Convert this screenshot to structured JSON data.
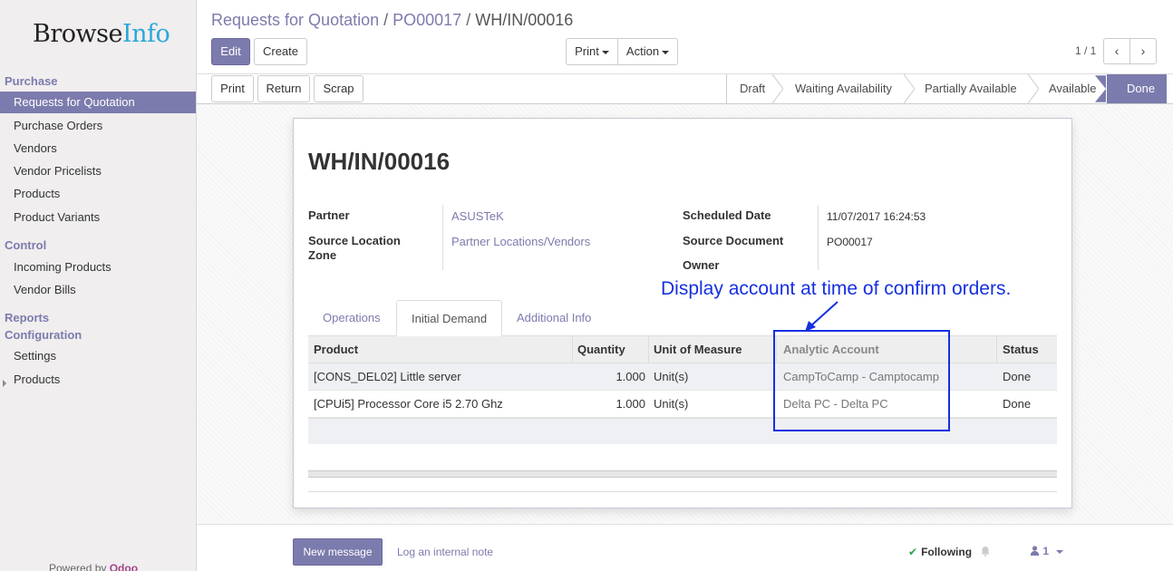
{
  "brand": {
    "part1": "Browse",
    "part2": "Info"
  },
  "sidebar": {
    "sections": [
      {
        "label": "Purchase"
      },
      {
        "label": "Control"
      },
      {
        "label": "Reports"
      },
      {
        "label": "Configuration"
      }
    ],
    "purchase_items": [
      "Requests for Quotation",
      "Purchase Orders",
      "Vendors",
      "Vendor Pricelists",
      "Products",
      "Product Variants"
    ],
    "control_items": [
      "Incoming Products",
      "Vendor Bills"
    ],
    "config_items": [
      "Settings",
      "Products"
    ],
    "powered_by": "Powered by",
    "powered_brand": "Odoo"
  },
  "breadcrumb": [
    "Requests for Quotation",
    "PO00017",
    "WH/IN/00016"
  ],
  "toolbar": {
    "edit": "Edit",
    "create": "Create",
    "print": "Print",
    "action": "Action"
  },
  "pager": {
    "text": "1 / 1",
    "prev": "‹",
    "next": "›"
  },
  "header_buttons": {
    "print": "Print",
    "return": "Return",
    "scrap": "Scrap"
  },
  "stages": [
    "Draft",
    "Waiting Availability",
    "Partially Available",
    "Available",
    "Done"
  ],
  "current_stage": "Done",
  "record": {
    "title": "WH/IN/00016",
    "partner_label": "Partner",
    "partner_value": "ASUSTeK",
    "source_location_label_1": "Source Location",
    "source_location_label_2": "Zone",
    "source_location_value": "Partner Locations/Vendors",
    "scheduled_date_label": "Scheduled Date",
    "scheduled_date_value": "11/07/2017 16:24:53",
    "source_document_label": "Source Document",
    "source_document_value": "PO00017",
    "owner_label": "Owner"
  },
  "annotation": "Display account at time of confirm orders.",
  "tabs": [
    "Operations",
    "Initial Demand",
    "Additional Info"
  ],
  "active_tab": "Initial Demand",
  "table": {
    "headers": [
      "Product",
      "Quantity",
      "Unit of Measure",
      "Analytic Account",
      "Status"
    ],
    "rows": [
      {
        "product": "[CONS_DEL02] Little server",
        "quantity": "1.000",
        "uom": "Unit(s)",
        "analytic": "CampToCamp - Camptocamp",
        "status": "Done"
      },
      {
        "product": "[CPUi5] Processor Core i5 2.70 Ghz",
        "quantity": "1.000",
        "uom": "Unit(s)",
        "analytic": "Delta PC - Delta PC",
        "status": "Done"
      }
    ]
  },
  "chatter": {
    "new_message": "New message",
    "log_note": "Log an internal note",
    "following": "Following",
    "followers": "1"
  },
  "colors": {
    "primary": "#7c7bad",
    "annotation": "#1530e0",
    "link": "#7c7bad"
  }
}
